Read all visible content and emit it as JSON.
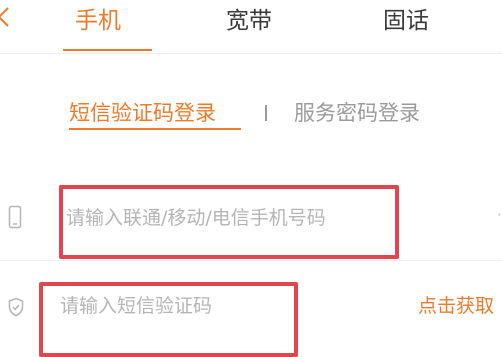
{
  "top_tabs": [
    {
      "label": "手机",
      "active": true
    },
    {
      "label": "宽带",
      "active": false
    },
    {
      "label": "固话",
      "active": false
    }
  ],
  "login_methods": [
    {
      "label": "短信验证码登录",
      "active": true
    },
    {
      "label": "服务密码登录",
      "active": false
    }
  ],
  "form": {
    "phone": {
      "icon": "phone-icon",
      "placeholder": "请输入联通/移动/电信手机号码",
      "value": ""
    },
    "sms_code": {
      "icon": "shield-icon",
      "placeholder": "请输入短信验证码",
      "value": "",
      "action_label": "点击获取"
    }
  },
  "colors": {
    "accent": "#f07a2a",
    "highlight_box": "#e0464e",
    "inactive_text": "#9b9b9b"
  }
}
